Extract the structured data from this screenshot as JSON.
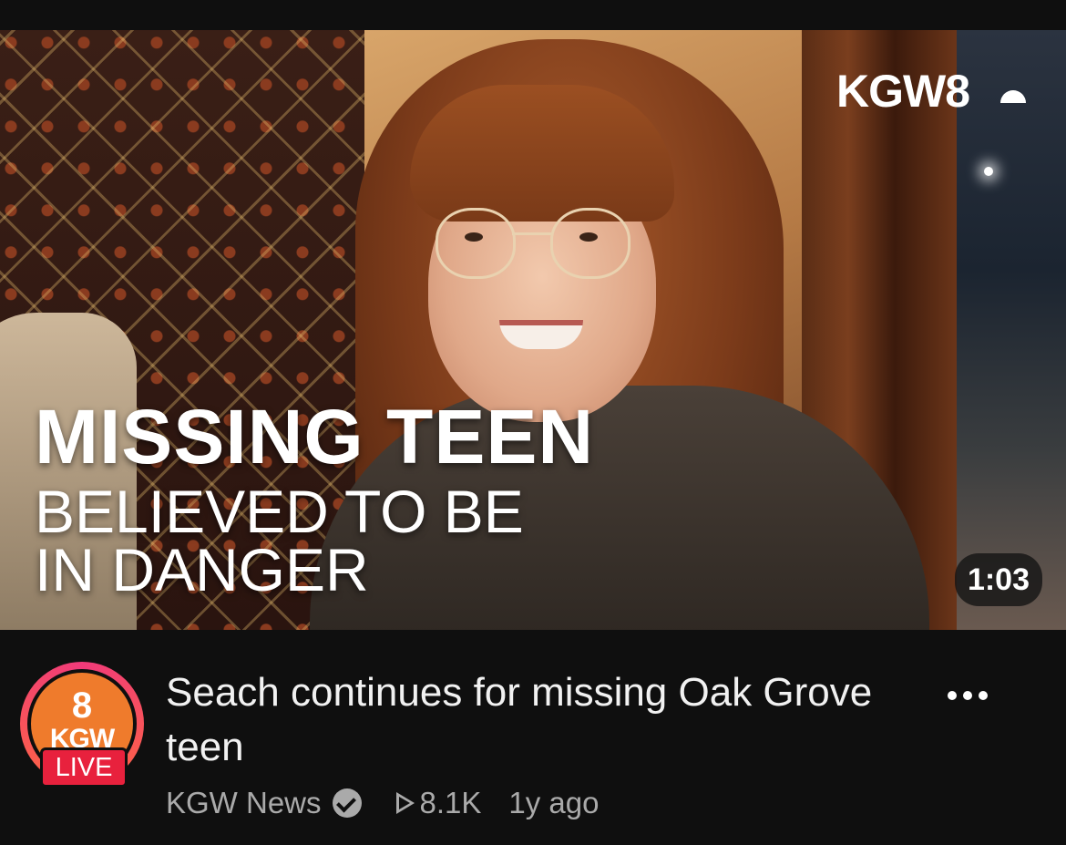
{
  "video": {
    "thumbnail": {
      "channel_logo_text": "KGW8",
      "headline_line1": "MISSING TEEN",
      "headline_line2": "BELIEVED TO BE",
      "headline_line3": "IN DANGER",
      "duration": "1:03"
    },
    "title": "Seach continues for missing Oak Grove teen",
    "channel": {
      "avatar_number": "8",
      "avatar_text": "KGW",
      "live_badge": "LIVE",
      "name": "KGW News",
      "verified": true
    },
    "views": "8.1K",
    "age": "1y ago",
    "more_menu_icon": "more-horizontal-icon"
  },
  "colors": {
    "background": "#0f0f0f",
    "live_red": "#e8213d",
    "avatar_orange": "#ef7b2c",
    "secondary_text": "#aaaaaa"
  }
}
